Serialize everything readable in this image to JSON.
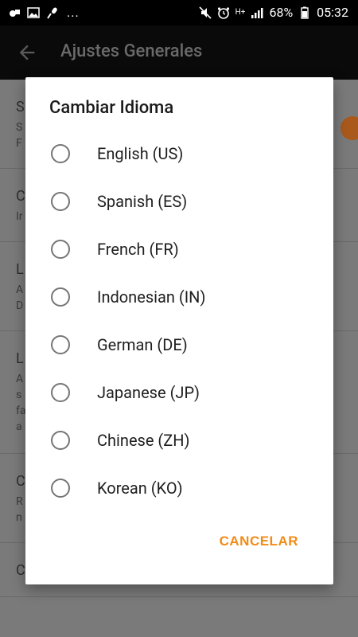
{
  "status_bar": {
    "battery": "68%",
    "time": "05:32",
    "network": "H+",
    "overflow": "..."
  },
  "toolbar": {
    "title": "Ajustes Generales"
  },
  "background_items": [
    {
      "title": "S",
      "sub1": "S",
      "sub2": "F"
    },
    {
      "title": "C",
      "sub1": "Ir"
    },
    {
      "title": "L",
      "sub1": "A",
      "sub2": "D"
    },
    {
      "title": "L",
      "sub1": "A",
      "sub2": "s",
      "sub3": "fa",
      "sub4": "a"
    },
    {
      "title": "C",
      "sub1": "R",
      "sub2": "n"
    },
    {
      "title": "C"
    }
  ],
  "dialog": {
    "title": "Cambiar Idioma",
    "options": [
      {
        "label": "English (US)"
      },
      {
        "label": "Spanish (ES)"
      },
      {
        "label": "French (FR)"
      },
      {
        "label": "Indonesian (IN)"
      },
      {
        "label": "German (DE)"
      },
      {
        "label": "Japanese (JP)"
      },
      {
        "label": "Chinese (ZH)"
      },
      {
        "label": "Korean (KO)"
      }
    ],
    "cancel_label": "CANCELAR"
  },
  "colors": {
    "accent": "#F28B16",
    "dialog_bg": "#FFFFFF",
    "status_bar": "#000000"
  }
}
